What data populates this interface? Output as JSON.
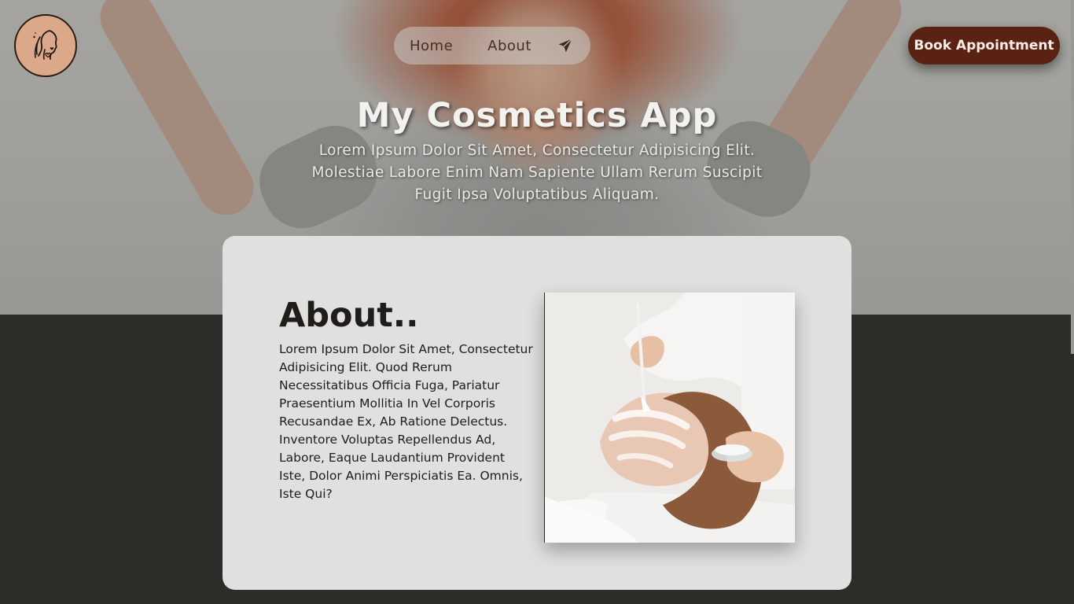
{
  "header": {
    "logo_icon": "face-hearts-icon",
    "nav": [
      {
        "label": "Home"
      },
      {
        "label": "About"
      }
    ],
    "nav_send_icon": "paper-plane-icon",
    "book_label": "Book Appointment"
  },
  "hero": {
    "title": "My Cosmetics App",
    "subtitle": "Lorem Ipsum Dolor Sit Amet, Consectetur Adipisicing Elit. Molestiae Labore Enim Nam Sapiente Ullam Rerum Suscipit Fugit Ipsa Voluptatibus Aliquam."
  },
  "about": {
    "title": "About..",
    "text": "Lorem Ipsum Dolor Sit Amet, Consectetur Adipisicing Elit. Quod Rerum Necessitatibus Officia Fuga, Pariatur Praesentium Mollitia In Vel Corporis Recusandae Ex, Ab Ratione Delectus. Inventore Voluptas Repellendus Ad, Labore, Eaque Laudantium Provident Iste, Dolor Animi Perspiciatis Ea. Omnis, Iste Qui?"
  },
  "colors": {
    "accent": "#5a2212",
    "logo_bg": "#dba98a",
    "dark_bg": "#2d2c29",
    "card_bg": "#e0e0de"
  }
}
